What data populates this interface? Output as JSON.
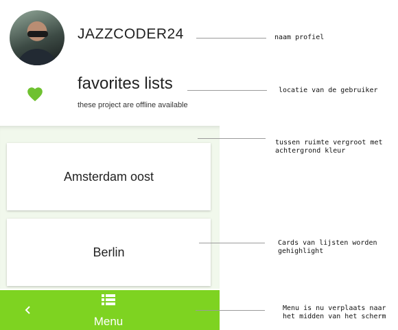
{
  "profile": {
    "username": "JAZZCODER24"
  },
  "favorites": {
    "title": "favorites lists",
    "subtitle": "these project are offline available"
  },
  "lists": [
    {
      "name": "Amsterdam oost"
    },
    {
      "name": "Berlin"
    }
  ],
  "menubar": {
    "menu_label": "Menu",
    "back_icon": "chevron-left-icon",
    "list_icon": "list-icon"
  },
  "annotations": [
    {
      "text": "naam profiel"
    },
    {
      "text": "locatie van de gebruiker"
    },
    {
      "text": "tussen ruimte vergroot met achtergrond kleur"
    },
    {
      "text": "Cards van lijsten worden gehighlight"
    },
    {
      "text": "Menu is nu verplaats naar het midden van het scherm"
    }
  ],
  "colors": {
    "accent": "#7ed321",
    "content_bg": "#f1f8ec",
    "heart": "#6fc130"
  }
}
